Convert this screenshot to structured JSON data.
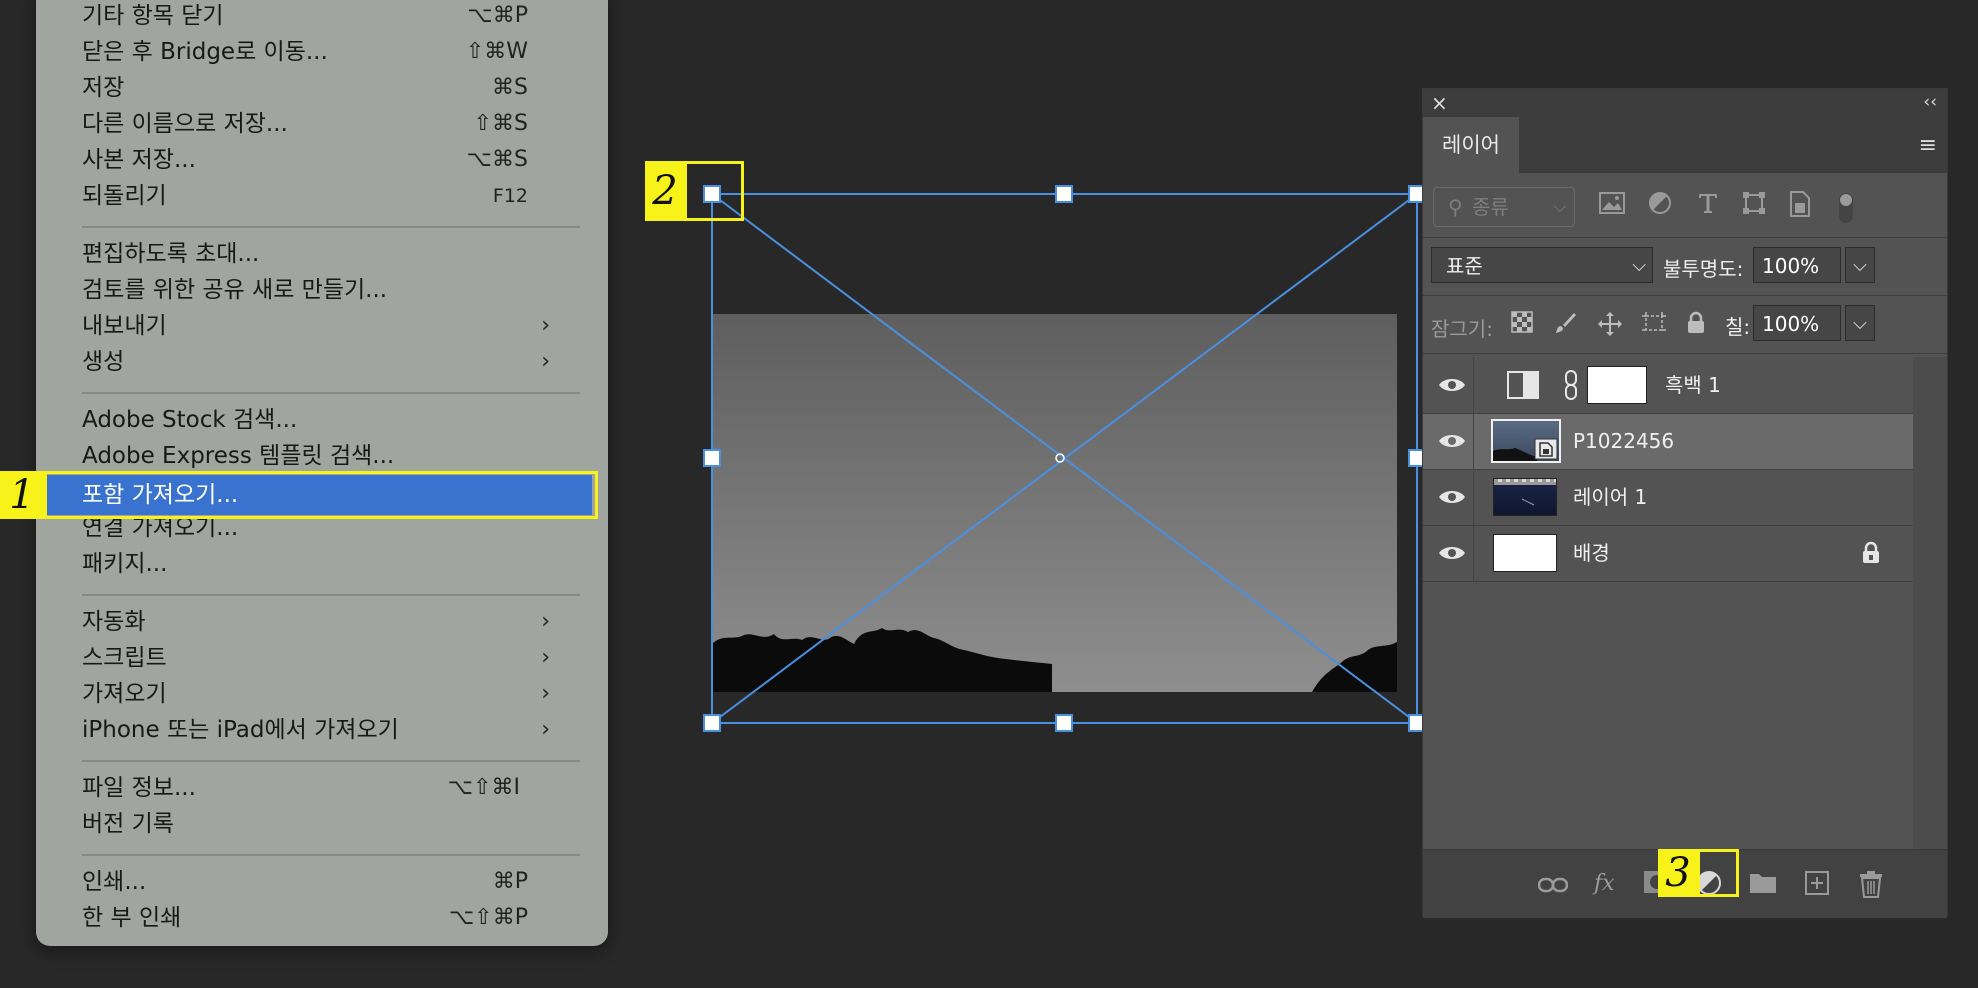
{
  "file_menu": {
    "items": [
      {
        "label": "기타 항목 닫기",
        "shortcut": "⌥⌘P"
      },
      {
        "label": "닫은 후 Bridge로 이동...",
        "shortcut": "⇧⌘W"
      },
      {
        "label": "저장",
        "shortcut": "⌘S"
      },
      {
        "label": "다른 이름으로 저장...",
        "shortcut": "⇧⌘S"
      },
      {
        "label": "사본 저장...",
        "shortcut": "⌥⌘S"
      },
      {
        "label": "되돌리기",
        "shortcut": "F12"
      },
      {
        "label": "편집하도록 초대..."
      },
      {
        "label": "검토를 위한 공유 새로 만들기..."
      },
      {
        "label": "내보내기",
        "submenu": true
      },
      {
        "label": "생성",
        "submenu": true
      },
      {
        "label": "Adobe Stock 검색..."
      },
      {
        "label": "Adobe Express 템플릿 검색..."
      },
      {
        "label": "포함 가져오기...",
        "highlighted": true
      },
      {
        "label": "연결 가져오기..."
      },
      {
        "label": "패키지..."
      },
      {
        "label": "자동화",
        "submenu": true
      },
      {
        "label": "스크립트",
        "submenu": true
      },
      {
        "label": "가져오기",
        "submenu": true
      },
      {
        "label": "iPhone 또는 iPad에서 가져오기",
        "submenu": true
      },
      {
        "label": "파일 정보...",
        "shortcut": "⌥⇧⌘I"
      },
      {
        "label": "버전 기록"
      },
      {
        "label": "인쇄...",
        "shortcut": "⌘P"
      },
      {
        "label": "한 부 인쇄",
        "shortcut": "⌥⇧⌘P"
      }
    ],
    "submenu_arrow": "›"
  },
  "callouts": {
    "one": "1",
    "two": "2",
    "three": "3"
  },
  "layers_panel": {
    "close_icon": "×",
    "collapse_icon": "‹‹",
    "tab_label": "레이어",
    "menu_icon": "≡",
    "filter": {
      "placeholder": "종류",
      "search_glyph": "⚲",
      "chevron": "⌵"
    },
    "blend_mode": "표준",
    "opacity_label": "불투명도:",
    "opacity_value": "100%",
    "lock_label": "잠그기:",
    "fill_label": "칠:",
    "fill_value": "100%",
    "dropdown_chevron": "⌵",
    "layers": [
      {
        "name": "흑백 1",
        "type": "adjustment"
      },
      {
        "name": "P1022456",
        "type": "smart-object",
        "selected": true
      },
      {
        "name": "레이어 1",
        "type": "image"
      },
      {
        "name": "배경",
        "type": "background",
        "locked": true
      }
    ]
  },
  "colors": {
    "highlight": "#3a73cf",
    "callout_yellow": "#f7f219",
    "transform_line": "#4a90e2",
    "panel_bg": "#535353"
  }
}
